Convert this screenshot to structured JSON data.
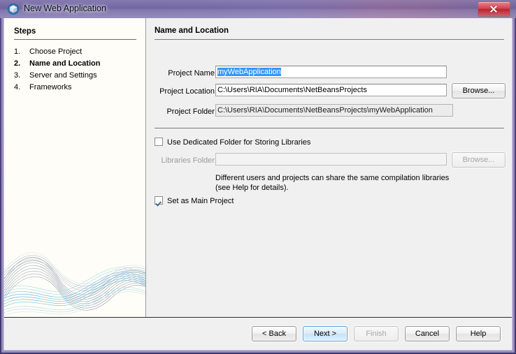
{
  "window": {
    "title": "New Web Application",
    "icon": "cube-icon",
    "close_label": "Close",
    "accent_purple": "#9d8dc0",
    "close_red": "#c2323f"
  },
  "steps": {
    "heading": "Steps",
    "items": [
      {
        "num": "1.",
        "label": "Choose Project",
        "current": false
      },
      {
        "num": "2.",
        "label": "Name and Location",
        "current": true
      },
      {
        "num": "3.",
        "label": "Server and Settings",
        "current": false
      },
      {
        "num": "4.",
        "label": "Frameworks",
        "current": false
      }
    ],
    "decoration": "wave-graphic"
  },
  "main": {
    "heading": "Name and Location",
    "fields": {
      "project_name": {
        "label": "Project Name:",
        "value": "myWebApplication",
        "selected": true
      },
      "project_location": {
        "label": "Project Location:",
        "value": "C:\\Users\\RIA\\Documents\\NetBeansProjects",
        "browse_label": "Browse..."
      },
      "project_folder": {
        "label": "Project Folder:",
        "value": "C:\\Users\\RIA\\Documents\\NetBeansProjects\\myWebApplication",
        "readonly": true
      },
      "libraries_folder": {
        "label": "Libraries Folder:",
        "value": "",
        "browse_label": "Browse...",
        "disabled": true
      }
    },
    "checkboxes": {
      "dedicated_folder": {
        "label": "Use Dedicated Folder for Storing Libraries",
        "checked": false
      },
      "main_project": {
        "label": "Set as Main Project",
        "checked": true
      }
    },
    "hint_line1": "Different users and projects can share the same compilation libraries",
    "hint_line2": "(see Help for details)."
  },
  "buttons": {
    "back": {
      "label": "< Back",
      "disabled": false
    },
    "next": {
      "label": "Next >",
      "default": true
    },
    "finish": {
      "label": "Finish",
      "disabled": true
    },
    "cancel": {
      "label": "Cancel",
      "disabled": false
    },
    "help": {
      "label": "Help",
      "disabled": false
    }
  },
  "colors": {
    "selection_blue": "#3399ff",
    "steps_panel": "#fffdf7",
    "main_panel": "#f0f0f0"
  }
}
